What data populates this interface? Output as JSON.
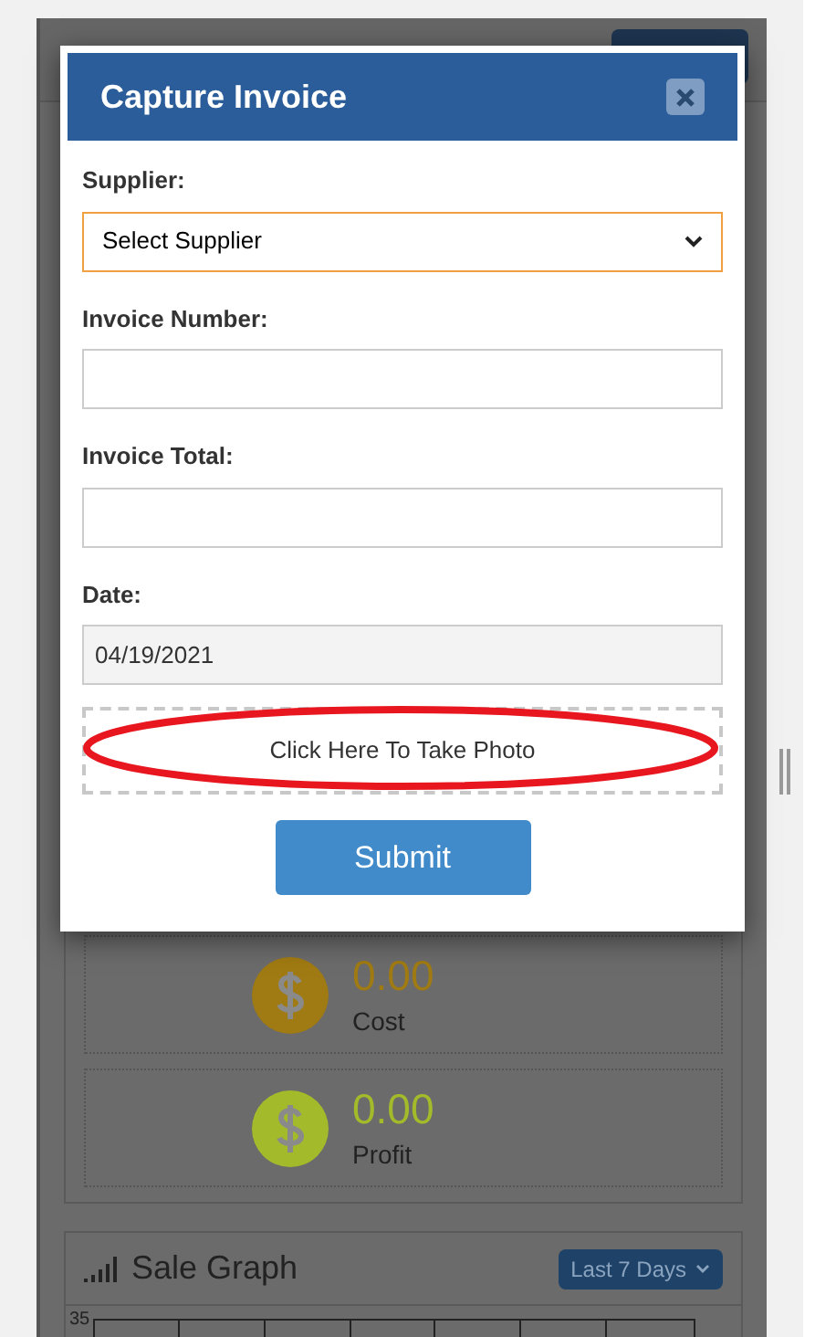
{
  "modal": {
    "title": "Capture Invoice",
    "fields": [
      {
        "kind": "select",
        "label": "Supplier:",
        "value": "Select Supplier",
        "focused": true,
        "readonly": false
      },
      {
        "kind": "text",
        "label": "Invoice Number:",
        "focused": false,
        "readonly": false
      },
      {
        "kind": "text",
        "label": "Invoice Total:",
        "focused": false,
        "readonly": false
      },
      {
        "kind": "text",
        "label": "Date:",
        "value": "04/19/2021",
        "focused": false,
        "readonly": true
      }
    ],
    "photo_button": "Click Here To Take Photo",
    "submit_button": "Submit"
  },
  "stats": [
    {
      "amount": "0.00",
      "label": "Cost",
      "color": "#a07a12"
    },
    {
      "amount": "0.00",
      "label": "Profit",
      "color": "#a3bb2a"
    }
  ],
  "sale_graph": {
    "title": "Sale Graph",
    "range_button": "Last 7 Days",
    "y_tick": "35"
  }
}
